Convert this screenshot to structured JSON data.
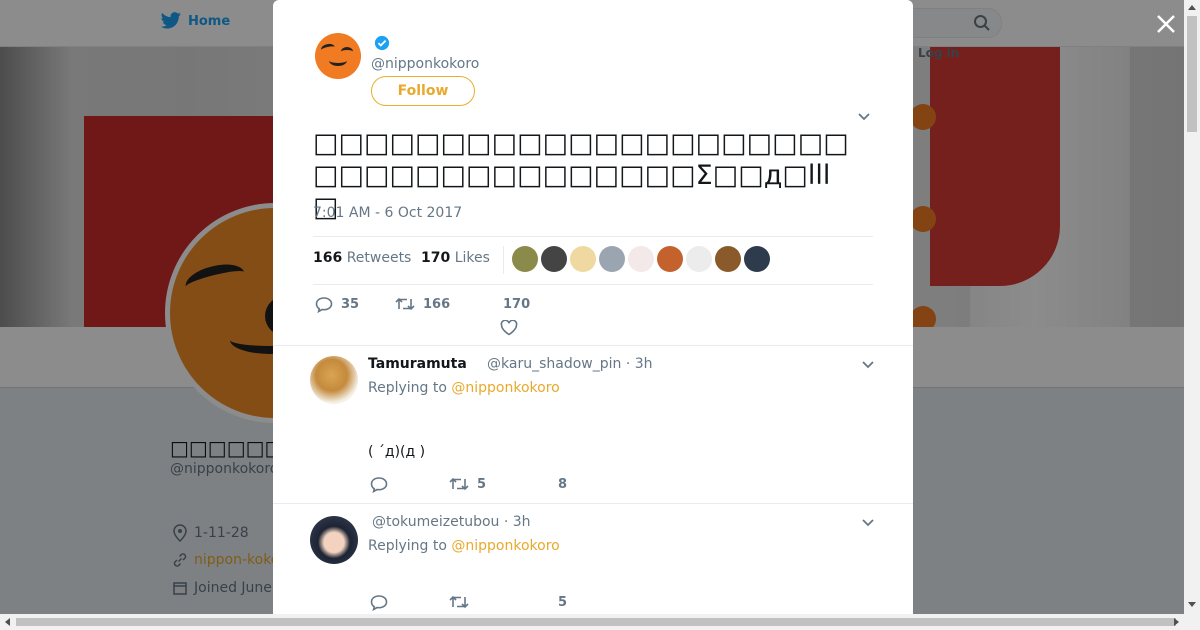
{
  "nav": {
    "home_label": "Home",
    "login_label": "Log in"
  },
  "profile": {
    "name": "□□□□□□",
    "handle": "@nipponkokoro",
    "location": "1-11-28",
    "website": "nippon-koko",
    "joined": "Joined June"
  },
  "tweet": {
    "author_handle": "@nipponkokoro",
    "follow_label": "Follow",
    "text": "□□□□□□□□□□□□□□□□□□□□□□□□□□□□□□□□□□□□Σ□□д□lll□",
    "time": "7:01 AM - 6 Oct 2017",
    "retweets_count": "166",
    "retweets_label": "Retweets",
    "likes_count": "170",
    "likes_label": "Likes",
    "actions": {
      "replies": "35",
      "retweets": "166",
      "likes": "170"
    }
  },
  "replies": [
    {
      "name": "Tamuramuta",
      "handle": "@karu_shadow_pin · 3h",
      "replying_prefix": "Replying to",
      "replying_to": "@nipponkokoro",
      "text": "( ´д)(д )",
      "retweets": "5",
      "likes": "8"
    },
    {
      "name": "",
      "handle": "@tokumeizetubou · 3h",
      "replying_prefix": "Replying to",
      "replying_to": "@nipponkokoro",
      "text": "",
      "retweets": "",
      "likes": "5"
    }
  ],
  "colors": {
    "accent": "#e8a92c",
    "twitter_blue": "#1da1f2",
    "avatar_orange": "#f07b22"
  },
  "icons": [
    "twitter-bird-icon",
    "search-icon",
    "close-icon",
    "verified-icon",
    "chevron-down-icon",
    "reply-icon",
    "retweet-icon",
    "heart-icon",
    "location-icon",
    "link-icon",
    "calendar-icon"
  ]
}
